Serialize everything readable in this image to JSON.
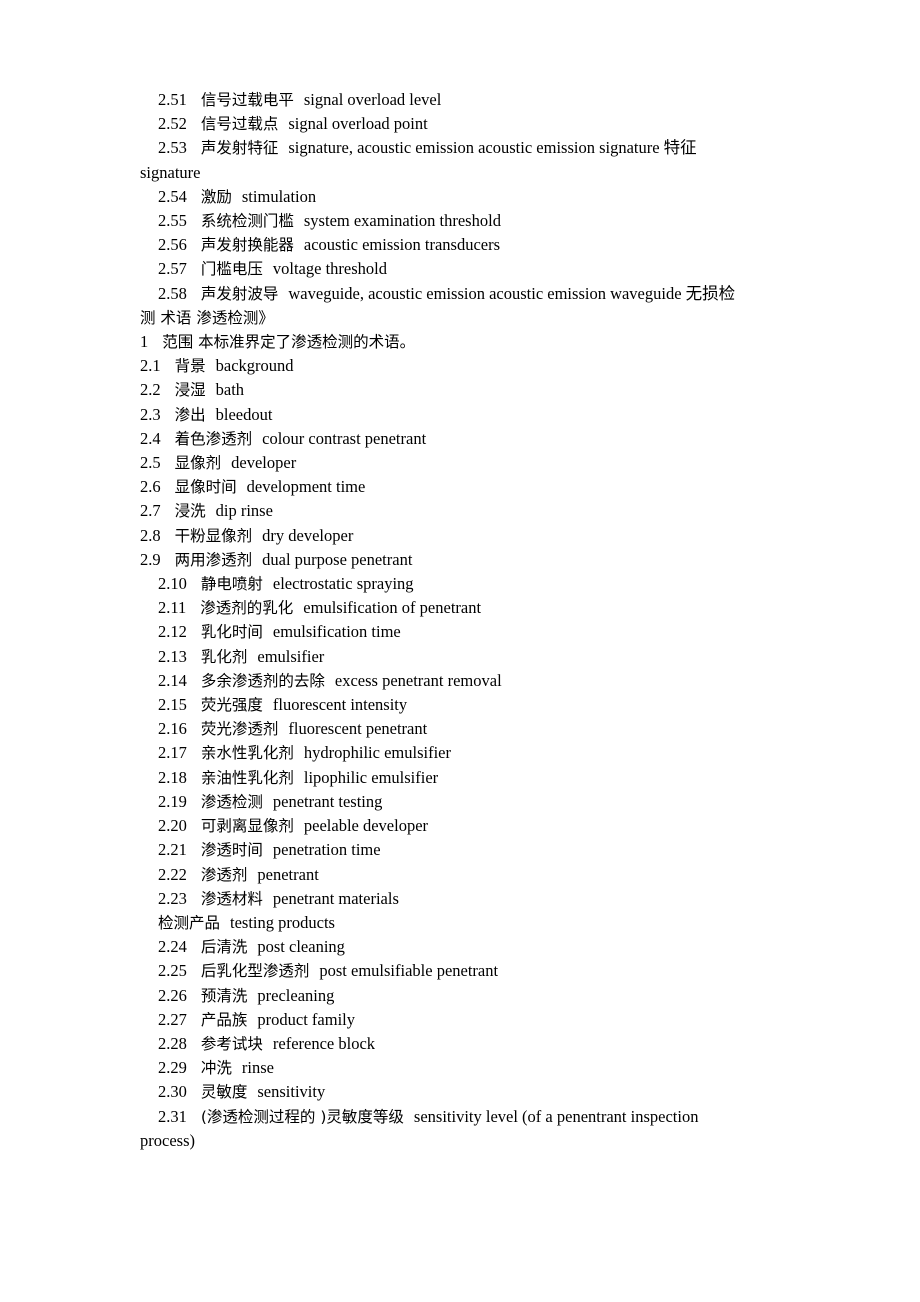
{
  "document": {
    "lines": [
      {
        "indent": true,
        "num": "2.51",
        "cn": "信号过载电平",
        "en": "signal overload level"
      },
      {
        "indent": true,
        "num": "2.52",
        "cn": "信号过载点",
        "en": "signal overload point"
      },
      {
        "indent": true,
        "num": "2.53",
        "cn": "声发射特征",
        "en": "signature, acoustic emission acoustic emission signature 特征"
      },
      {
        "indent": false,
        "num": "",
        "cn": "",
        "en": "signature"
      },
      {
        "indent": true,
        "num": "2.54",
        "cn": "激励",
        "en": "stimulation"
      },
      {
        "indent": true,
        "num": "2.55",
        "cn": "系统检测门槛",
        "en": "system examination threshold"
      },
      {
        "indent": true,
        "num": "2.56",
        "cn": "声发射换能器",
        "en": "acoustic emission transducers"
      },
      {
        "indent": true,
        "num": "2.57",
        "cn": "门槛电压",
        "en": "voltage threshold"
      },
      {
        "indent": true,
        "num": "2.58",
        "cn": "声发射波导",
        "en": "waveguide, acoustic emission acoustic emission waveguide 无损检"
      },
      {
        "indent": false,
        "num": "",
        "cn": "测 术语 渗透检测》",
        "en": ""
      },
      {
        "indent": false,
        "num": "1",
        "cn": "范围 本标准界定了渗透检测的术语。",
        "en": ""
      },
      {
        "indent": false,
        "num": "2.1",
        "cn": "背景",
        "en": "background"
      },
      {
        "indent": false,
        "num": "2.2",
        "cn": "浸湿",
        "en": "bath"
      },
      {
        "indent": false,
        "num": "2.3",
        "cn": "渗出",
        "en": "bleedout"
      },
      {
        "indent": false,
        "num": "2.4",
        "cn": "着色渗透剂",
        "en": "colour contrast penetrant"
      },
      {
        "indent": false,
        "num": "2.5",
        "cn": "显像剂",
        "en": "developer"
      },
      {
        "indent": false,
        "num": "2.6",
        "cn": "显像时间",
        "en": "development time"
      },
      {
        "indent": false,
        "num": "2.7",
        "cn": "浸洗",
        "en": "dip rinse"
      },
      {
        "indent": false,
        "num": "2.8",
        "cn": "干粉显像剂",
        "en": "dry developer"
      },
      {
        "indent": false,
        "num": "2.9",
        "cn": "两用渗透剂",
        "en": "dual purpose penetrant"
      },
      {
        "indent": true,
        "num": "2.10",
        "cn": "静电喷射",
        "en": "electrostatic spraying"
      },
      {
        "indent": true,
        "num": "2.11",
        "cn": "渗透剂的乳化",
        "en": "emulsification of penetrant"
      },
      {
        "indent": true,
        "num": "2.12",
        "cn": "乳化时间",
        "en": "emulsification time"
      },
      {
        "indent": true,
        "num": "2.13",
        "cn": "乳化剂",
        "en": "emulsifier"
      },
      {
        "indent": true,
        "num": "2.14",
        "cn": "多余渗透剂的去除",
        "en": "excess penetrant removal"
      },
      {
        "indent": true,
        "num": "2.15",
        "cn": "荧光强度",
        "en": "fluorescent intensity"
      },
      {
        "indent": true,
        "num": "2.16",
        "cn": "荧光渗透剂",
        "en": "fluorescent penetrant"
      },
      {
        "indent": true,
        "num": "2.17",
        "cn": "亲水性乳化剂",
        "en": "hydrophilic emulsifier"
      },
      {
        "indent": true,
        "num": "2.18",
        "cn": "亲油性乳化剂",
        "en": "lipophilic emulsifier"
      },
      {
        "indent": true,
        "num": "2.19",
        "cn": "渗透检测",
        "en": "penetrant testing"
      },
      {
        "indent": true,
        "num": "2.20",
        "cn": "可剥离显像剂",
        "en": "peelable developer"
      },
      {
        "indent": true,
        "num": "2.21",
        "cn": "渗透时间",
        "en": "penetration time"
      },
      {
        "indent": true,
        "num": "2.22",
        "cn": "渗透剂",
        "en": "penetrant"
      },
      {
        "indent": true,
        "num": "2.23",
        "cn": "渗透材料",
        "en": "penetrant materials"
      },
      {
        "indent": true,
        "num": "",
        "cn": "检测产品",
        "en": "testing products"
      },
      {
        "indent": true,
        "num": "2.24",
        "cn": "后清洗",
        "en": "post cleaning"
      },
      {
        "indent": true,
        "num": "2.25",
        "cn": "后乳化型渗透剂",
        "en": "post emulsifiable penetrant"
      },
      {
        "indent": true,
        "num": "2.26",
        "cn": "预清洗",
        "en": "precleaning"
      },
      {
        "indent": true,
        "num": "2.27",
        "cn": "产品族",
        "en": "product family"
      },
      {
        "indent": true,
        "num": "2.28",
        "cn": "参考试块",
        "en": "reference block"
      },
      {
        "indent": true,
        "num": "2.29",
        "cn": "冲洗",
        "en": "rinse"
      },
      {
        "indent": true,
        "num": "2.30",
        "cn": "灵敏度",
        "en": "sensitivity"
      },
      {
        "indent": true,
        "num": "2.31",
        "cn": "(渗透检测过程的 )灵敏度等级",
        "en": "sensitivity level (of a penentrant inspection"
      },
      {
        "indent": false,
        "num": "",
        "cn": "",
        "en": "process)"
      }
    ]
  }
}
